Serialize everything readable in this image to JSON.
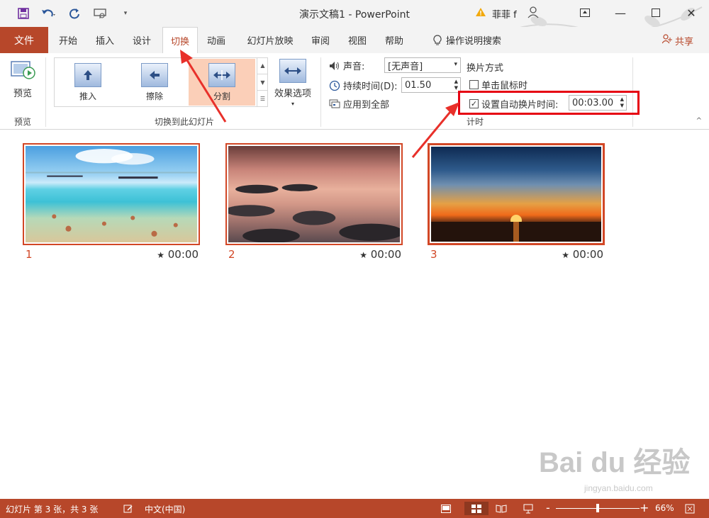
{
  "window": {
    "title": "演示文稿1 - PowerPoint",
    "user_name": "菲菲 f"
  },
  "tabs": {
    "file": "文件",
    "items": [
      "开始",
      "插入",
      "设计",
      "切换",
      "动画",
      "幻灯片放映",
      "审阅",
      "视图",
      "帮助"
    ],
    "active": "切换",
    "tell_me": "操作说明搜索",
    "share": "共享"
  },
  "ribbon": {
    "preview_group": {
      "button": "预览",
      "label": "预览"
    },
    "transitions_group": {
      "items": [
        "推入",
        "擦除",
        "分割"
      ],
      "selected": "分割",
      "effect_options": "效果选项",
      "label": "切换到此幻灯片"
    },
    "timing_group": {
      "sound_label": "声音:",
      "sound_value": "[无声音]",
      "duration_label": "持续时间(D):",
      "duration_value": "01.50",
      "apply_all": "应用到全部",
      "advance_title": "换片方式",
      "on_click_label": "单击鼠标时",
      "on_click_checked": false,
      "auto_label": "设置自动换片时间:",
      "auto_checked": true,
      "auto_value": "00:03.00",
      "label": "计时"
    }
  },
  "slides": [
    {
      "number": "1",
      "time": "00:00",
      "star": "★"
    },
    {
      "number": "2",
      "time": "00:00",
      "star": "★"
    },
    {
      "number": "3",
      "time": "00:00",
      "star": "★"
    }
  ],
  "statusbar": {
    "slide_info": "幻灯片 第 3 张，共 3 张",
    "language": "中文(中国)",
    "zoom_minus": "-",
    "zoom_plus": "+",
    "zoom": "66%",
    "zoom_level": 0.5
  },
  "watermark": {
    "main": "Bai du 经验",
    "sub": "jingyan.baidu.com"
  },
  "colors": {
    "accent": "#b7472a",
    "highlight": "#e60012"
  }
}
